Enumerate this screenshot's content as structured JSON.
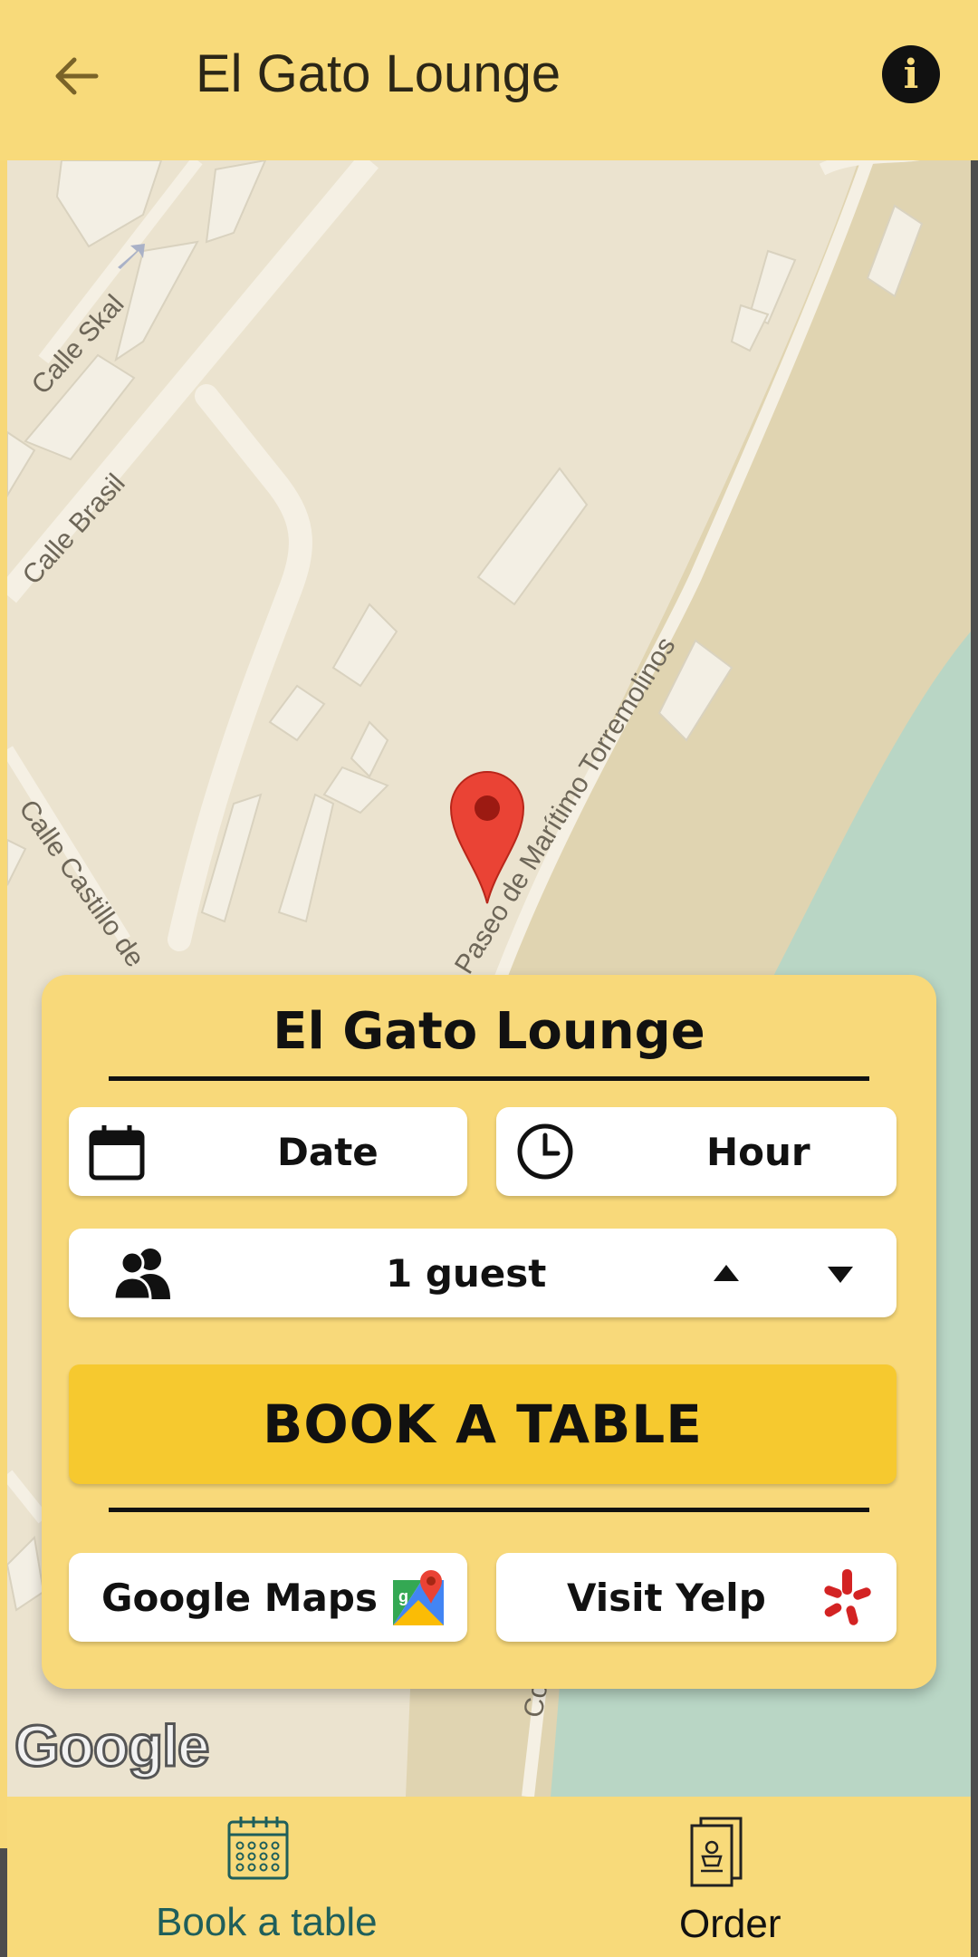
{
  "appbar": {
    "title": "El Gato Lounge"
  },
  "map": {
    "streets": [
      "Calle Skal",
      "Calle Brasil",
      "Calle Castillo de",
      "Paseo de Marítimo Torremolinos",
      "Co"
    ],
    "attribution": "Google",
    "marker": "location-pin-icon"
  },
  "booking": {
    "title": "El Gato Lounge",
    "date_label": "Date",
    "hour_label": "Hour",
    "guests_label": "1 guest",
    "book_label": "BOOK A TABLE",
    "maps_label": "Google Maps",
    "yelp_label": "Visit Yelp"
  },
  "bottom_nav": {
    "items": [
      {
        "label": "Book a table",
        "icon": "calendar-grid-icon",
        "active": true
      },
      {
        "label": "Order",
        "icon": "menu-icon",
        "active": false
      }
    ]
  },
  "colors": {
    "accent": "#f8da7a",
    "button": "#f6c92f",
    "active_nav": "#1f5f5b",
    "marker": "#ea4335"
  }
}
